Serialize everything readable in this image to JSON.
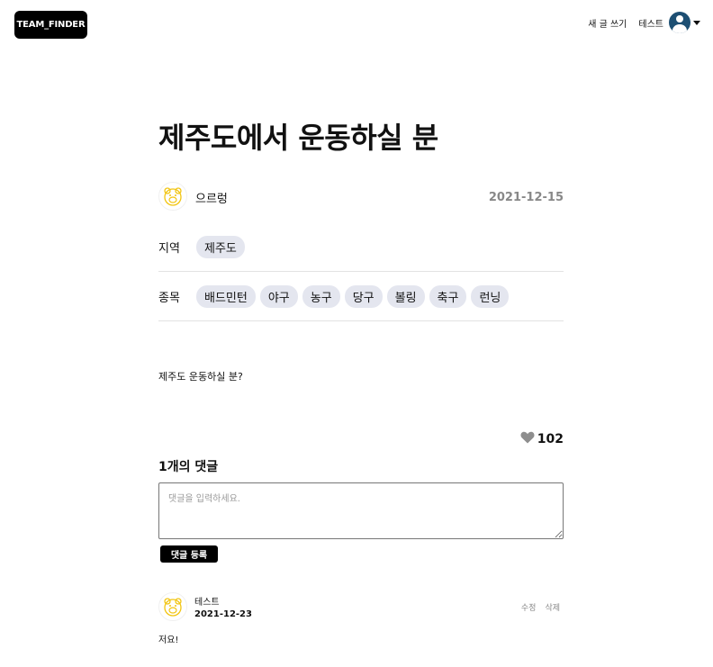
{
  "header": {
    "logo": "TEAM_FINDER",
    "write_label": "새 글 쓰기",
    "username": "테스트"
  },
  "post": {
    "title": "제주도에서 운동하실 분",
    "author": "으르렁",
    "date": "2021-12-15",
    "region_label": "지역",
    "region": "제주도",
    "sports_label": "종목",
    "sports": [
      "배드민턴",
      "야구",
      "농구",
      "당구",
      "볼링",
      "축구",
      "런닝"
    ],
    "content": "제주도 운동하실 분?",
    "likes": "102"
  },
  "comments": {
    "title": "1개의 댓글",
    "placeholder": "댓글을 입력하세요.",
    "submit_label": "댓글 등록",
    "items": [
      {
        "author": "테스트",
        "date": "2021-12-23",
        "edit_label": "수정",
        "delete_label": "삭제",
        "text": "저요!"
      }
    ]
  }
}
